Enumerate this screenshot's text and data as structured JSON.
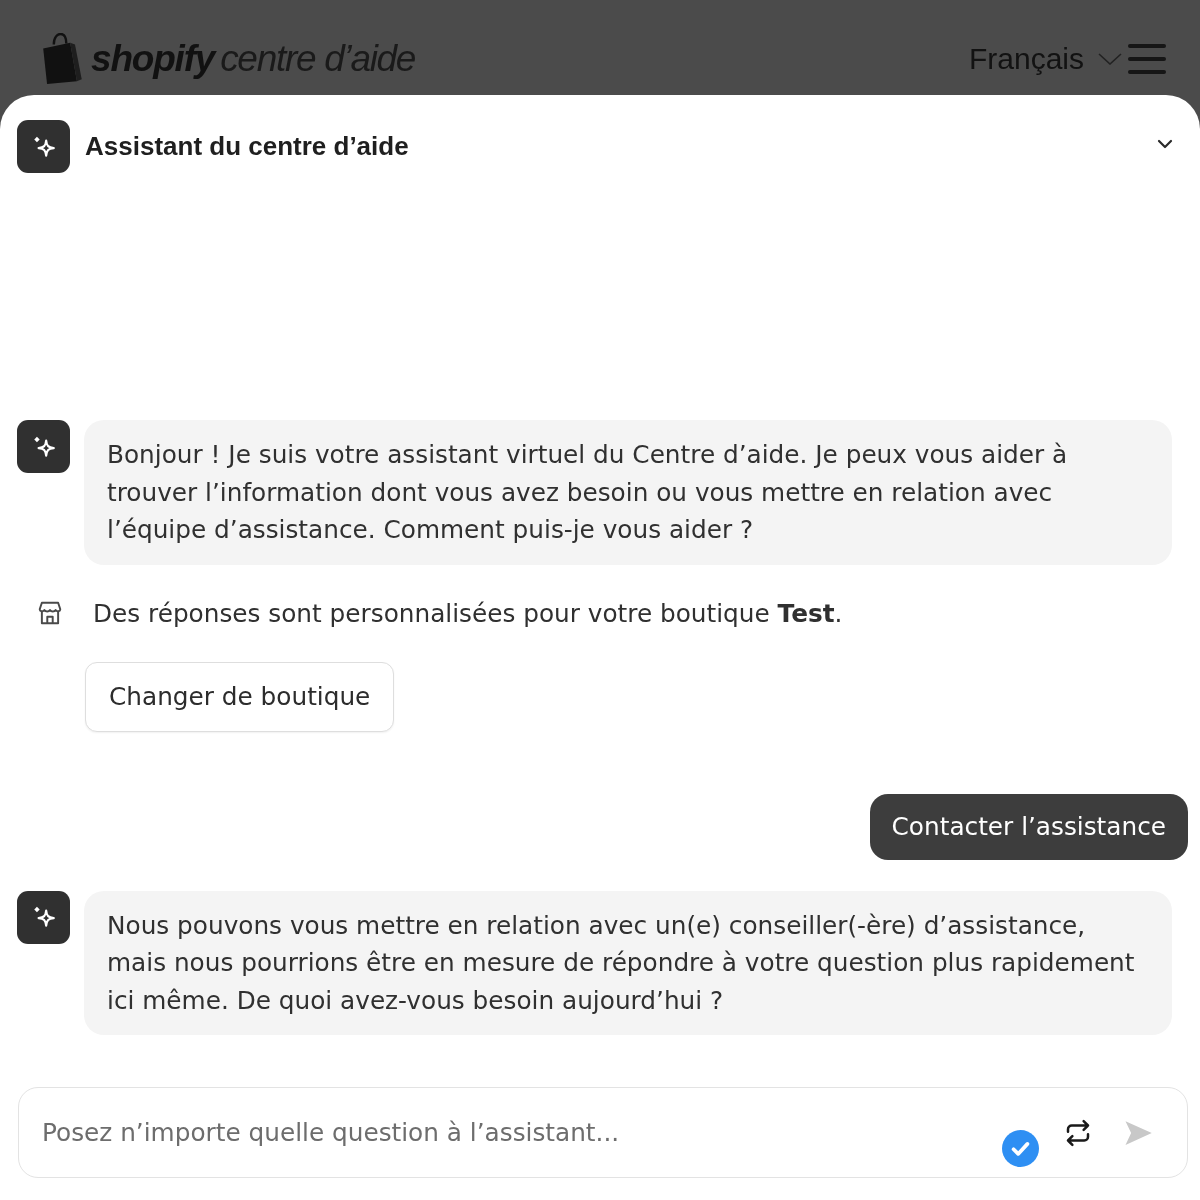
{
  "header": {
    "logo": {
      "wordmark": "shopify",
      "tagline": "centre d’aide"
    },
    "language": "Français"
  },
  "assistant": {
    "title": "Assistant du centre d’aide"
  },
  "messages": [
    {
      "kind": "bot",
      "text": "Bonjour ! Je suis votre assistant virtuel du Centre d’aide. Je peux vous aider à trouver l’information dont vous avez besoin ou vous mettre en relation avec l’équipe d’assistance. Comment puis-je vous aider ?"
    },
    {
      "kind": "note",
      "text": "Des réponses sont personnalisées pour votre boutique **Test**.",
      "button": "Changer de boutique"
    },
    {
      "kind": "user",
      "text": "Contacter l’assistance"
    },
    {
      "kind": "bot",
      "text": "Nous pouvons vous mettre en relation avec un(e) conseiller(-ère) d’assistance, mais nous pourrions être en mesure de répondre à votre question plus rapidement ici même. De quoi avez-vous besoin aujourd’hui ?"
    }
  ],
  "composer": {
    "placeholder": "Posez n’importe quelle question à l’assistant..."
  }
}
